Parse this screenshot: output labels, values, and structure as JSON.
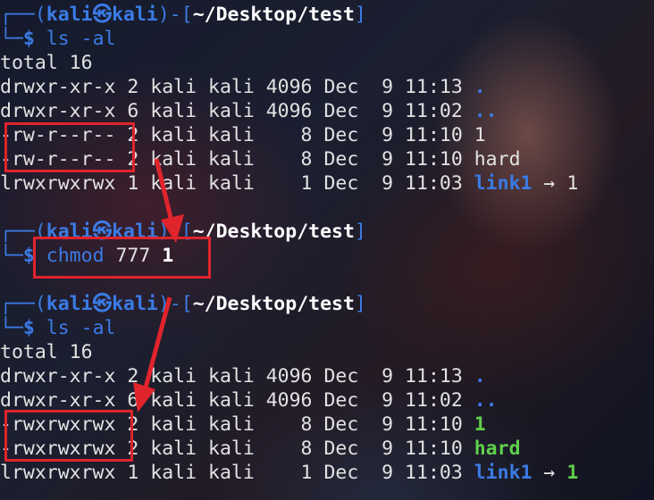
{
  "prompt": {
    "user": "kali",
    "host": "kali",
    "separator": "㉿",
    "path": "~/Desktop/test",
    "dollar": "$"
  },
  "block1": {
    "command": "ls -al",
    "total": "total 16",
    "rows": [
      {
        "perms": "drwxr-xr-x",
        "rest": " 2 kali kali 4096 Dec  9 11:13 ",
        "name": "."
      },
      {
        "perms": "drwxr-xr-x",
        "rest": " 6 kali kali 4096 Dec  9 11:02 ",
        "name": ".."
      },
      {
        "perms": "-rw-r--r--",
        "rest": " 2 kali kali    8 Dec  9 11:10 ",
        "name": "1"
      },
      {
        "perms": "-rw-r--r--",
        "rest": " 2 kali kali    8 Dec  9 11:10 ",
        "name": "hard"
      },
      {
        "perms": "lrwxrwxrwx",
        "rest": " 1 kali kali    1 Dec  9 11:03 ",
        "name": "link1",
        "arrow": " → ",
        "target": "1"
      }
    ]
  },
  "block2": {
    "cmd_name": "chmod",
    "cmd_mode": " 777 ",
    "cmd_arg": "1"
  },
  "block3": {
    "command": "ls -al",
    "total": "total 16",
    "rows": [
      {
        "perms": "drwxr-xr-x",
        "rest": " 2 kali kali 4096 Dec  9 11:13 ",
        "name": "."
      },
      {
        "perms": "drwxr-xr-x",
        "rest": " 6 kali kali 4096 Dec  9 11:02 ",
        "name": ".."
      },
      {
        "perms": "-rwxrwxrwx",
        "rest": " 2 kali kali    8 Dec  9 11:10 ",
        "name": "1"
      },
      {
        "perms": "-rwxrwxrwx",
        "rest": " 2 kali kali    8 Dec  9 11:10 ",
        "name": "hard"
      },
      {
        "perms": "lrwxrwxrwx",
        "rest": " 1 kali kali    1 Dec  9 11:03 ",
        "name": "link1",
        "arrow": " → ",
        "target": "1"
      }
    ]
  },
  "colors": {
    "prompt_blue": "#3b7be5",
    "exec_green": "#5fd04a",
    "highlight_red": "#e0242c"
  }
}
